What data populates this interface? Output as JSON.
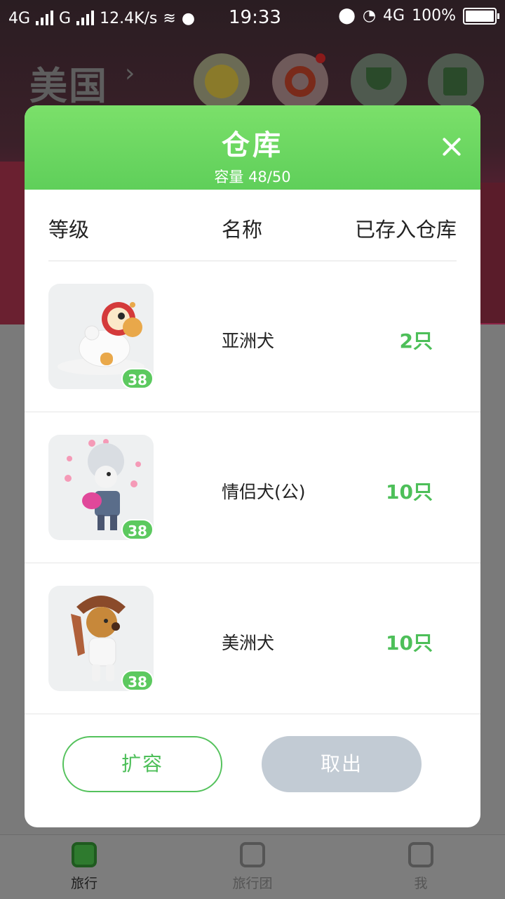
{
  "status_bar": {
    "network_left": "4G",
    "network_mid": "G",
    "speed": "12.4K/s",
    "time": "19:33",
    "network_right": "4G",
    "battery": "100%"
  },
  "background": {
    "country": "美国",
    "tabs": [
      {
        "label": "旅行"
      },
      {
        "label": "旅行团"
      },
      {
        "label": "我"
      }
    ]
  },
  "modal": {
    "title": "仓库",
    "capacity": "容量 48/50",
    "columns": {
      "level": "等级",
      "name": "名称",
      "stored": "已存入仓库"
    },
    "items": [
      {
        "level": "38",
        "name": "亚洲犬",
        "count": "2只"
      },
      {
        "level": "38",
        "name": "情侣犬(公)",
        "count": "10只"
      },
      {
        "level": "38",
        "name": "美洲犬",
        "count": "10只"
      }
    ],
    "buttons": {
      "expand": "扩容",
      "take_out": "取出"
    }
  },
  "colors": {
    "accent": "#5fcf5a",
    "count_green": "#4dbf59",
    "disabled_button": "#c2cbd4"
  }
}
